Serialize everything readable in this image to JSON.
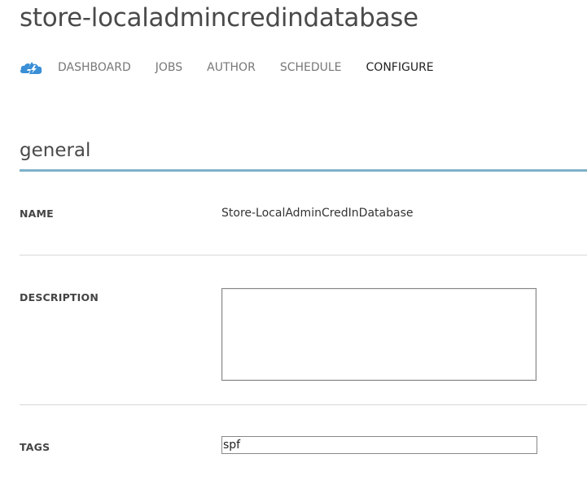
{
  "header": {
    "title": "store-localadmincredindatabase"
  },
  "nav": {
    "icon": "automation-cloud-icon",
    "tabs": [
      {
        "label": "DASHBOARD"
      },
      {
        "label": "JOBS"
      },
      {
        "label": "AUTHOR"
      },
      {
        "label": "SCHEDULE"
      },
      {
        "label": "CONFIGURE"
      }
    ],
    "active_tab": "CONFIGURE"
  },
  "section": {
    "title": "general"
  },
  "fields": {
    "name": {
      "label": "NAME",
      "value": "Store-LocalAdminCredInDatabase"
    },
    "description": {
      "label": "DESCRIPTION",
      "value": ""
    },
    "tags": {
      "label": "TAGS",
      "value": "spf"
    }
  },
  "colors": {
    "accent_rule": "#7fb1c9",
    "icon_blue": "#3a8fd6"
  }
}
